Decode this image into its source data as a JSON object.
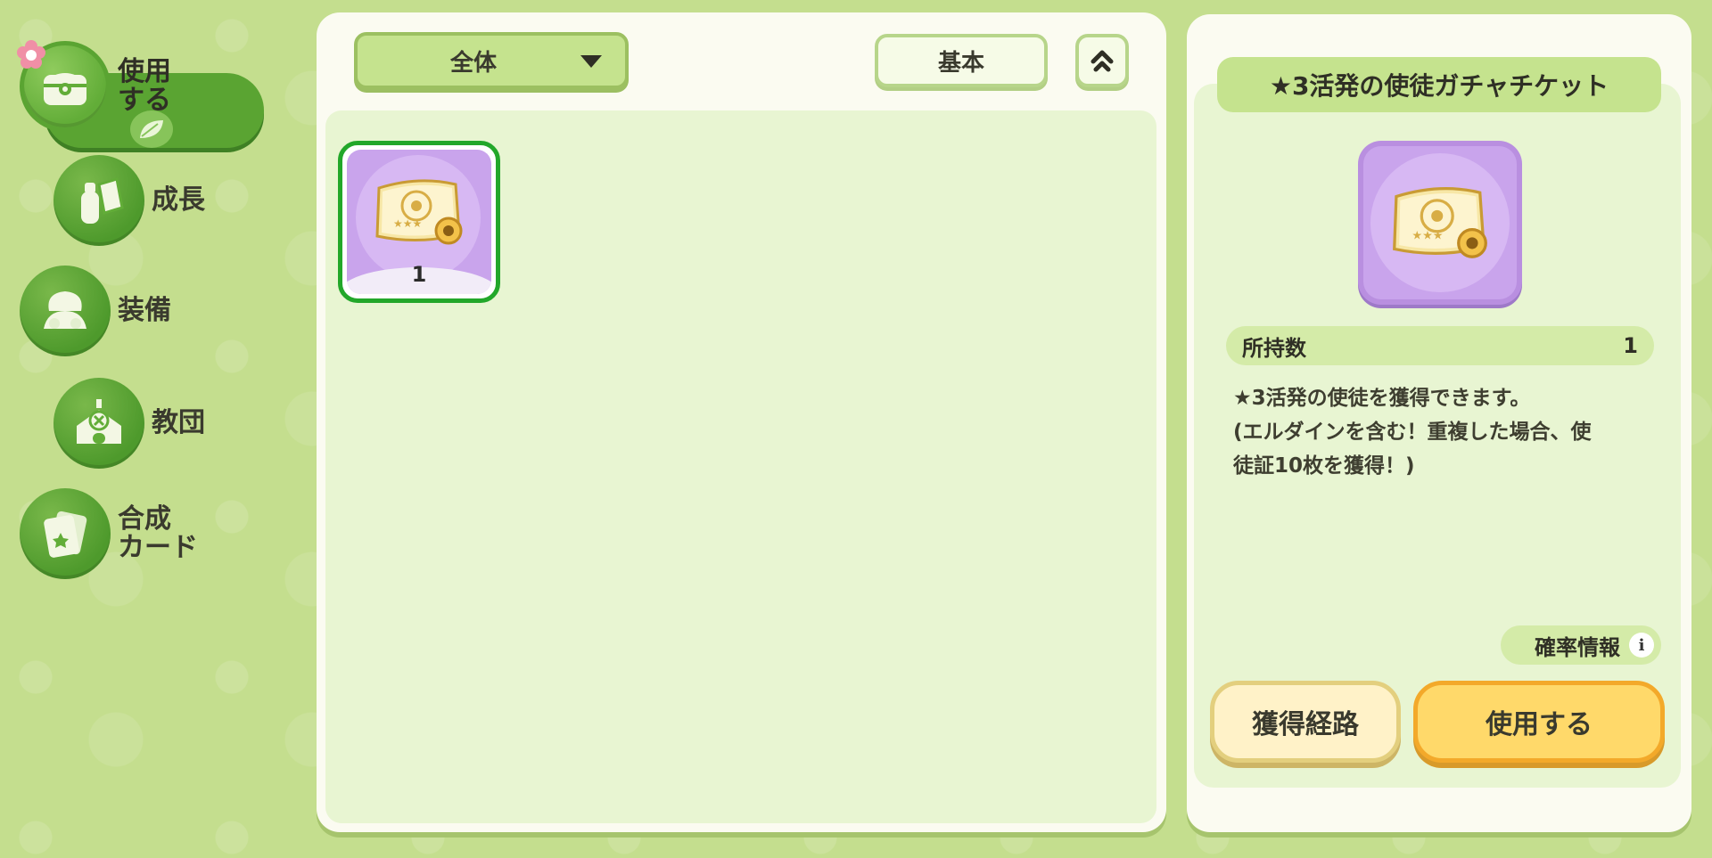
{
  "sidebar": {
    "items": [
      {
        "label": "使用\nする",
        "icon": "chest-icon",
        "active": true
      },
      {
        "label": "成長",
        "icon": "potion-icon",
        "active": false
      },
      {
        "label": "装備",
        "icon": "outfit-icon",
        "active": false
      },
      {
        "label": "教団",
        "icon": "building-icon",
        "active": false
      },
      {
        "label": "合成\nカード",
        "icon": "card-icon",
        "active": false
      }
    ]
  },
  "inventory": {
    "filter_label": "全体",
    "sort_label": "基本",
    "items": [
      {
        "name": "★3活発の使徒ガチャチケット",
        "count": "1",
        "icon": "gacha-ticket-icon",
        "selected": true
      }
    ]
  },
  "detail": {
    "title": "★3活発の使徒ガチャチケット",
    "owned_label": "所持数",
    "owned_value": "1",
    "description": "★3活発の使徒を獲得できます。\n(エルダインを含む！重複した場合、使\n徒証10枚を獲得！)",
    "probability_label": "確率情報",
    "route_button": "獲得経路",
    "use_button": "使用する"
  },
  "colors": {
    "background": "#c4de8e",
    "accent_green": "#5aa432",
    "item_purple": "#c9a4ec",
    "use_button": "#ffd96a"
  }
}
